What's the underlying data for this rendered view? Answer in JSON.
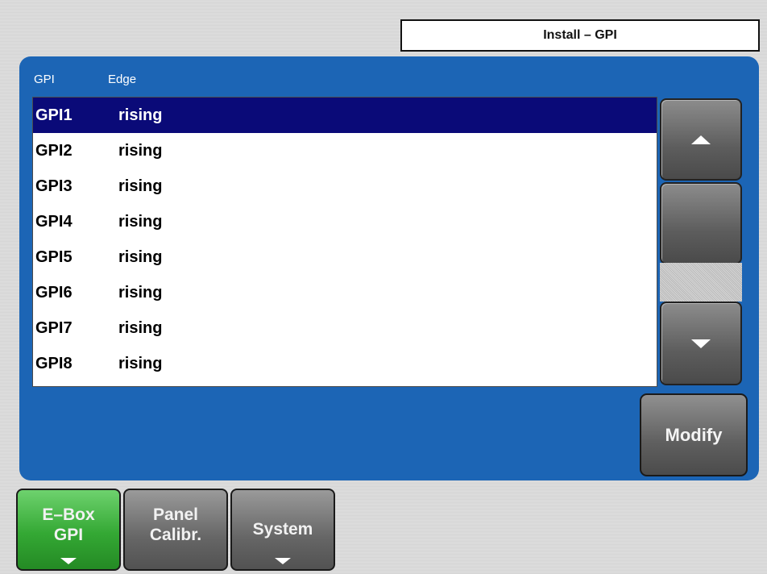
{
  "header": {
    "title": "Install – GPI"
  },
  "list": {
    "columns": [
      "GPI",
      "Edge"
    ],
    "rows": [
      {
        "gpi": "GPI1",
        "edge": "rising",
        "selected": true
      },
      {
        "gpi": "GPI2",
        "edge": "rising"
      },
      {
        "gpi": "GPI3",
        "edge": "rising"
      },
      {
        "gpi": "GPI4",
        "edge": "rising"
      },
      {
        "gpi": "GPI5",
        "edge": "rising"
      },
      {
        "gpi": "GPI6",
        "edge": "rising"
      },
      {
        "gpi": "GPI7",
        "edge": "rising"
      },
      {
        "gpi": "GPI8",
        "edge": "rising"
      }
    ]
  },
  "buttons": {
    "modify": "Modify"
  },
  "tabs": [
    {
      "line1": "E–Box",
      "line2": "GPI",
      "active": true,
      "has_menu": true
    },
    {
      "line1": "Panel",
      "line2": "Calibr.",
      "active": false,
      "has_menu": false
    },
    {
      "line1": "System",
      "line2": "",
      "active": false,
      "has_menu": true
    }
  ],
  "colors": {
    "panel": "#1c65b5",
    "selection": "#0a0a78",
    "active_tab": "#34a834"
  },
  "icons": {
    "scroll_up": "triangle-up-icon",
    "scroll_down": "triangle-down-icon",
    "tab_menu": "caret-down-icon"
  }
}
